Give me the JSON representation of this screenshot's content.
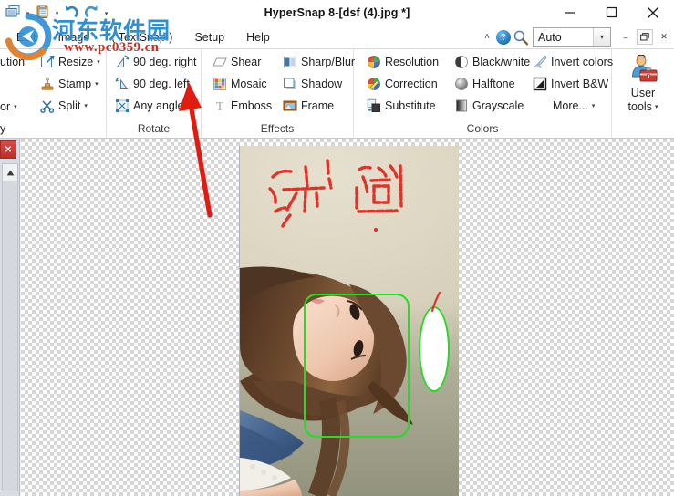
{
  "window": {
    "title_app": "HyperSnap 8",
    "title_sep": " - ",
    "title_doc": "[dsf (4).jpg *]",
    "minimize": "—",
    "maximize": "□",
    "close": "✕"
  },
  "quick_access": {
    "items": [
      {
        "name": "capture-icon",
        "caret": "▾"
      },
      {
        "name": "paste-icon",
        "caret": "▾"
      },
      {
        "name": "undo-icon",
        "caret": ""
      },
      {
        "name": "redo-icon",
        "caret": ""
      },
      {
        "name": "customize-qat-icon",
        "caret": "▾"
      }
    ]
  },
  "menu": {
    "items": [
      {
        "label": "Edit"
      },
      {
        "label": "Image"
      },
      {
        "label": "( TextSnap )"
      },
      {
        "label": "Setup"
      },
      {
        "label": "Help"
      }
    ],
    "collapse_ribbon": "˄",
    "help_glyph": "?",
    "zoom_combo_value": "Auto",
    "combo_arrow": "▾",
    "mdi_minimize": "–",
    "mdi_restore": "❐",
    "mdi_close": "✕"
  },
  "watermark": {
    "site_cn": "河东软件园",
    "site_url": "www.pc0359.cn"
  },
  "ribbon": {
    "groups": [
      {
        "name": "image-group",
        "label": "",
        "col1": [
          {
            "label": "ution",
            "icon": "resolution-icon",
            "dd": ""
          },
          {
            "label": "",
            "icon": "",
            "dd": ""
          },
          {
            "label": "or",
            "icon": "",
            "dd": "▾"
          },
          {
            "label": "y",
            "icon": "",
            "dd": ""
          }
        ],
        "col2": [
          {
            "label": "Resize",
            "icon": "resize-icon",
            "dd": "▾"
          },
          {
            "label": "Stamp",
            "icon": "stamp-icon",
            "dd": "▾"
          },
          {
            "label": "Split",
            "icon": "split-scissors-icon",
            "dd": "▾"
          }
        ]
      },
      {
        "name": "rotate-group",
        "label": "Rotate",
        "items": [
          {
            "label": "90 deg. right",
            "icon": "rotate-right-icon"
          },
          {
            "label": "90 deg. left",
            "icon": "rotate-left-icon"
          },
          {
            "label": "Any angle",
            "icon": "any-angle-icon"
          }
        ]
      },
      {
        "name": "effects-group",
        "label": "Effects",
        "col1": [
          {
            "label": "Shear",
            "icon": "shear-icon"
          },
          {
            "label": "Mosaic",
            "icon": "mosaic-icon"
          },
          {
            "label": "Emboss",
            "icon": "emboss-icon"
          }
        ],
        "col2": [
          {
            "label": "Sharp/Blur",
            "icon": "sharp-blur-icon"
          },
          {
            "label": "Shadow",
            "icon": "shadow-icon"
          },
          {
            "label": "Frame",
            "icon": "frame-icon"
          }
        ]
      },
      {
        "name": "colors-group",
        "label": "Colors",
        "col1": [
          {
            "label": "Resolution",
            "icon": "color-resolution-icon"
          },
          {
            "label": "Correction",
            "icon": "color-correction-icon"
          },
          {
            "label": "Substitute",
            "icon": "color-substitute-icon"
          }
        ],
        "col2": [
          {
            "label": "Black/white",
            "icon": "black-white-icon"
          },
          {
            "label": "Halftone",
            "icon": "halftone-icon"
          },
          {
            "label": "Grayscale",
            "icon": "grayscale-icon"
          }
        ],
        "col3": [
          {
            "label": "Invert colors",
            "icon": "invert-colors-icon",
            "dd": ""
          },
          {
            "label": "Invert B&W",
            "icon": "invert-bw-icon",
            "dd": ""
          },
          {
            "label": "More...",
            "icon": "",
            "dd": "▾"
          }
        ]
      }
    ],
    "user_tools": {
      "line1": "User",
      "line2": "tools",
      "dd": "▾",
      "icon": "user-tools-icon"
    }
  },
  "workspace": {
    "panel_close": "✕",
    "scroll_up": "▲",
    "document_name": "dsf (4).jpg"
  },
  "annotations": {
    "arrow_color": "#e01b10",
    "rect_color": "#20e020",
    "ellipse_color": "#27d927",
    "stroke_color": "#e03228"
  },
  "colors": {
    "accent": "#2d8fd5",
    "watermark_red": "#d42a1c",
    "title_text": "#111111",
    "canvas_checker": "#d6d6d6"
  }
}
